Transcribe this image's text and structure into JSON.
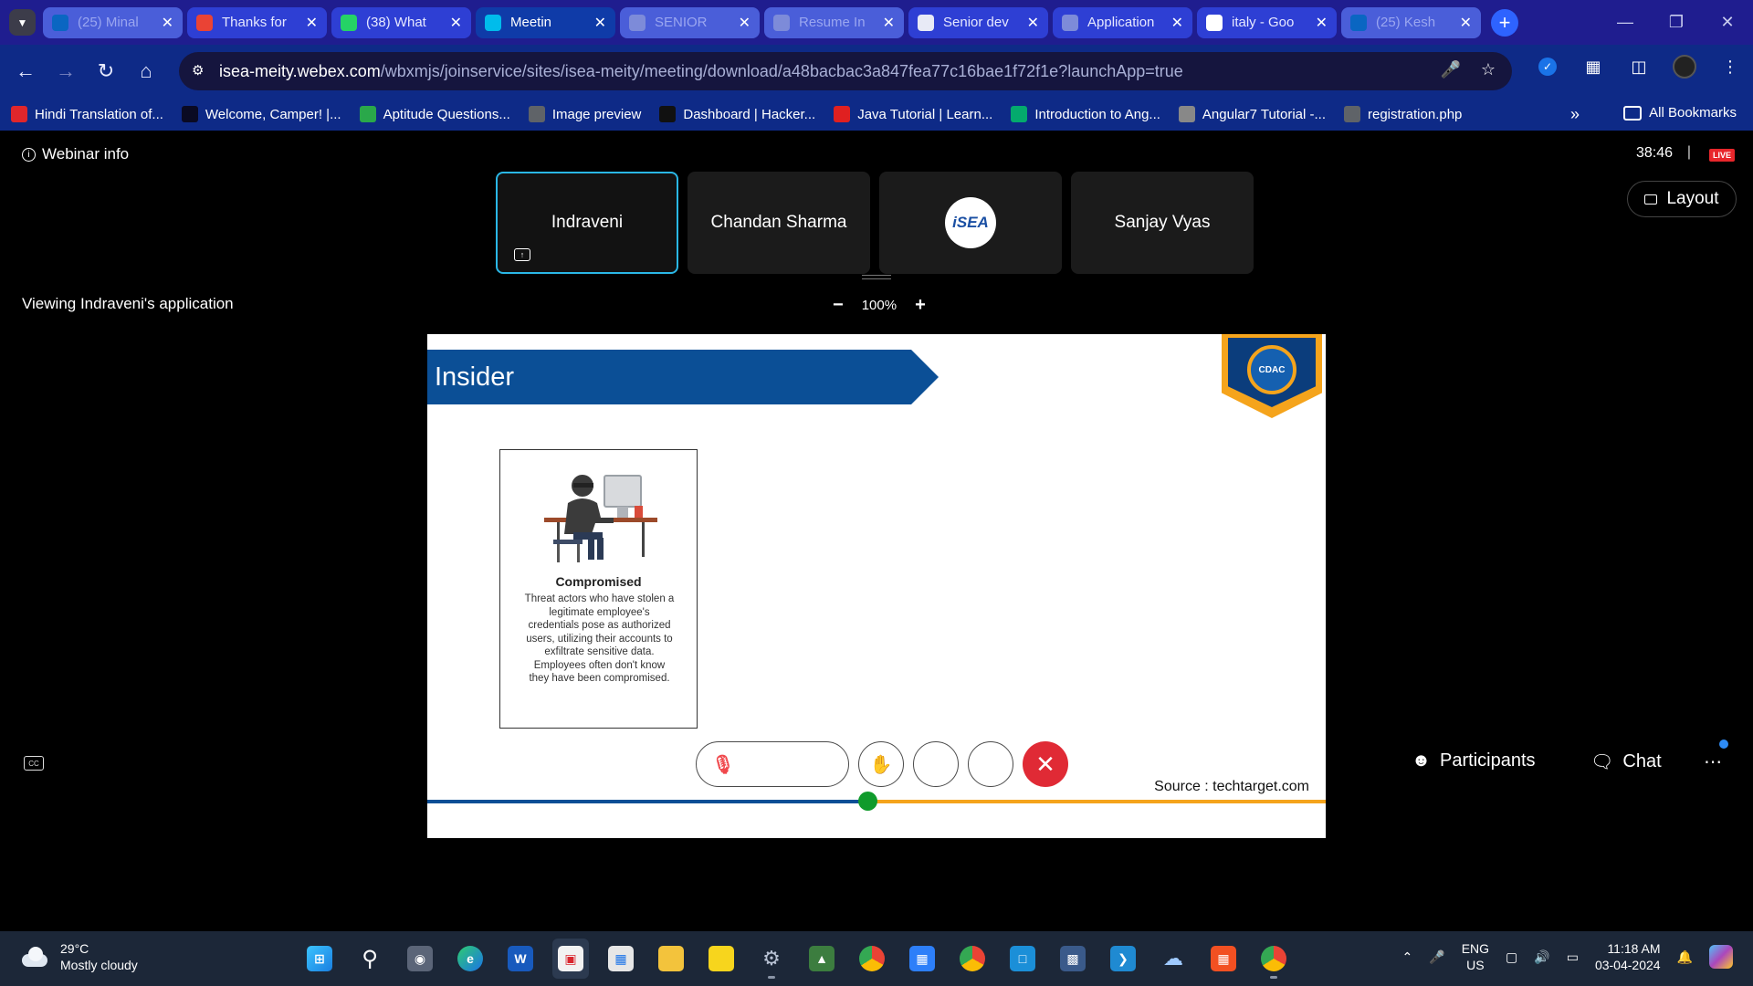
{
  "browser": {
    "tabs": [
      {
        "title": "(25) Minal",
        "favicon": "linkedin-icon",
        "color": "#0a66c2",
        "state": "dim"
      },
      {
        "title": "Thanks for",
        "favicon": "gmail-icon",
        "color": "#ea4335",
        "state": "normal"
      },
      {
        "title": "(38) What",
        "favicon": "whatsapp-icon",
        "color": "#25d366",
        "state": "normal"
      },
      {
        "title": "Meetin",
        "favicon": "webex-icon",
        "color": "#00bceb",
        "state": "active"
      },
      {
        "title": "SENIOR",
        "favicon": "globe-icon",
        "color": "#7d8bd9",
        "state": "dim"
      },
      {
        "title": "Resume In",
        "favicon": "globe-icon",
        "color": "#7d8bd9",
        "state": "dim"
      },
      {
        "title": "Senior dev",
        "favicon": "app-icon",
        "color": "#e8eaf6",
        "state": "normal"
      },
      {
        "title": "Application",
        "favicon": "globe-icon",
        "color": "#7d8bd9",
        "state": "normal"
      },
      {
        "title": "italy - Goo",
        "favicon": "google-icon",
        "color": "#ffffff",
        "state": "normal"
      },
      {
        "title": "(25) Kesh",
        "favicon": "linkedin-icon",
        "color": "#0a66c2",
        "state": "dim"
      }
    ],
    "url_host": "isea-meity.webex.com",
    "url_path": "/wbxmjs/joinservice/sites/isea-meity/meeting/download/a48bacbac3a847fea77c16bae1f72f1e?launchApp=true",
    "bookmarks": [
      {
        "label": "Hindi Translation of...",
        "icon": "c-logo-icon",
        "color": "#e0262b"
      },
      {
        "label": "Welcome, Camper! |...",
        "icon": "freecodecamp-icon",
        "color": "#0a0a23"
      },
      {
        "label": "Aptitude Questions...",
        "icon": "indiabix-icon",
        "color": "#2aa84a"
      },
      {
        "label": "Image preview",
        "icon": "globe-icon",
        "color": "#5f6368"
      },
      {
        "label": "Dashboard | Hacker...",
        "icon": "hackerrank-icon",
        "color": "#111111"
      },
      {
        "label": "Java Tutorial | Learn...",
        "icon": "javatpoint-icon",
        "color": "#e02020"
      },
      {
        "label": "Introduction to Ang...",
        "icon": "w3-icon",
        "color": "#04aa6d"
      },
      {
        "label": "Angular7 Tutorial -...",
        "icon": "tutorialspoint-icon",
        "color": "#888888"
      },
      {
        "label": "registration.php",
        "icon": "globe-icon",
        "color": "#5f6368"
      }
    ],
    "all_bookmarks": "All Bookmarks"
  },
  "meeting": {
    "webinar_info": "Webinar info",
    "timer": "38:46",
    "live": "LIVE",
    "layout": "Layout",
    "participants": [
      {
        "name": "Indraveni",
        "active": true
      },
      {
        "name": "Chandan Sharma",
        "active": false
      },
      {
        "name": "",
        "logo": "iSEA",
        "active": false
      },
      {
        "name": "Sanjay Vyas",
        "active": false
      }
    ],
    "viewing": "Viewing Indraveni's application",
    "zoom": "100%"
  },
  "slide": {
    "title": "Insider",
    "cdac_seal": "CDAC",
    "card_title": "Compromised",
    "card_body": "Threat actors who have stolen a legitimate employee's credentials pose as authorized users, utilizing their accounts to exfiltrate sensitive data. Employees often don't know they have been compromised.",
    "source": "Source : techtarget.com",
    "timeline_progress": 0.49
  },
  "controls": {
    "unmute": "Unmute",
    "participants": "Participants",
    "chat": "Chat"
  },
  "taskbar": {
    "temperature": "29°C",
    "weather": "Mostly cloudy",
    "lang_1": "ENG",
    "lang_2": "US",
    "time": "11:18 AM",
    "date": "03-04-2024"
  }
}
